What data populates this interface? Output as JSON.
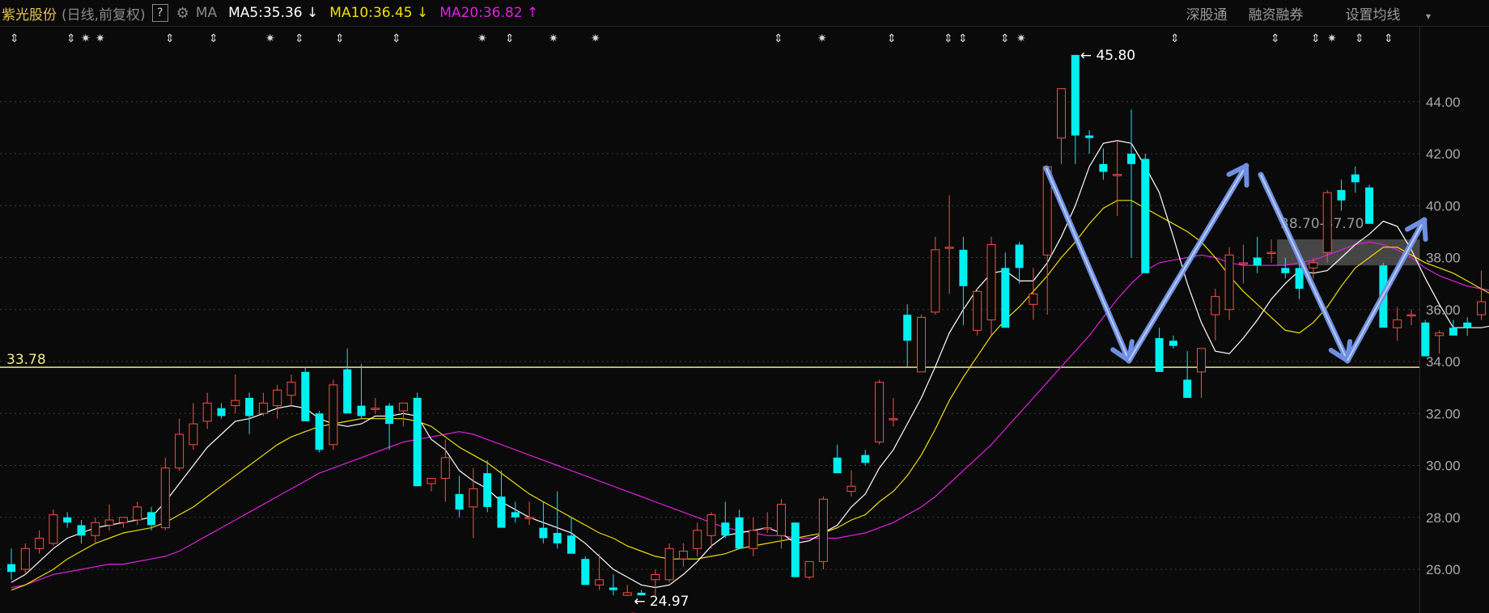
{
  "header": {
    "stock_name": "紫光股份",
    "mode": "(日线,前复权)",
    "help_label": "?",
    "ma_label": "MA",
    "ma5": "MA5:35.36",
    "ma5_arrow": "↓",
    "ma10": "MA10:36.45",
    "ma10_arrow": "↓",
    "ma20": "MA20:36.82",
    "ma20_arrow": "↑",
    "right_items": [
      "深股通",
      "融资融券",
      "设置均线"
    ],
    "dropdown_glyph": "▾"
  },
  "colors": {
    "up": "#ff4a4a",
    "down": "#00f0f0",
    "ma5": "#ffffff",
    "ma10": "#f0e000",
    "ma20": "#e020e0",
    "support": "#f0ea8a",
    "arrow": "#6f8fe0"
  },
  "chart_data": {
    "type": "candlestick",
    "yticks": [
      "44.00",
      "42.00",
      "40.00",
      "38.00",
      "36.00",
      "34.00",
      "32.00",
      "30.00",
      "28.00",
      "26.00"
    ],
    "ylim": [
      24.2,
      46.8
    ],
    "support_line": {
      "value": 33.78,
      "label": "33.78"
    },
    "zone": {
      "low": 37.7,
      "high": 38.7,
      "label": "38.70-37.70"
    },
    "high_label": "45.80",
    "low_label": "24.97",
    "low_marker": "S",
    "ohlc": [
      [
        26.2,
        26.8,
        25.6,
        25.9
      ],
      [
        26.0,
        27.0,
        25.8,
        26.8
      ],
      [
        26.8,
        27.5,
        26.6,
        27.2
      ],
      [
        27.0,
        28.3,
        26.9,
        28.1
      ],
      [
        28.0,
        28.2,
        27.6,
        27.8
      ],
      [
        27.7,
        27.9,
        27.0,
        27.3
      ],
      [
        27.3,
        28.0,
        27.0,
        27.8
      ],
      [
        27.7,
        28.5,
        27.5,
        27.9
      ],
      [
        27.8,
        28.0,
        27.6,
        28.0
      ],
      [
        27.9,
        28.6,
        27.7,
        28.4
      ],
      [
        28.2,
        28.4,
        27.5,
        27.7
      ],
      [
        27.6,
        30.3,
        27.5,
        29.9
      ],
      [
        29.9,
        31.8,
        29.8,
        31.2
      ],
      [
        30.8,
        32.4,
        30.6,
        31.6
      ],
      [
        31.7,
        32.8,
        31.4,
        32.4
      ],
      [
        32.2,
        32.4,
        31.8,
        31.9
      ],
      [
        32.3,
        33.5,
        32.0,
        32.5
      ],
      [
        32.6,
        32.8,
        31.2,
        31.9
      ],
      [
        32.0,
        32.8,
        31.9,
        32.4
      ],
      [
        32.3,
        33.1,
        31.8,
        32.9
      ],
      [
        32.7,
        33.5,
        32.3,
        33.2
      ],
      [
        33.6,
        33.8,
        31.8,
        31.7
      ],
      [
        32.0,
        32.1,
        30.5,
        30.6
      ],
      [
        30.8,
        33.3,
        30.6,
        33.1
      ],
      [
        33.7,
        34.5,
        32.0,
        32.0
      ],
      [
        32.3,
        33.9,
        31.8,
        31.9
      ],
      [
        32.2,
        32.6,
        32.0,
        32.2
      ],
      [
        32.3,
        32.4,
        30.6,
        31.6
      ],
      [
        32.1,
        32.3,
        31.5,
        32.4
      ],
      [
        32.6,
        32.8,
        29.2,
        29.2
      ],
      [
        29.3,
        29.5,
        29.0,
        29.5
      ],
      [
        29.5,
        31.0,
        28.6,
        30.3
      ],
      [
        28.9,
        29.6,
        28.0,
        28.3
      ],
      [
        28.4,
        29.9,
        27.2,
        29.1
      ],
      [
        29.7,
        30.2,
        28.2,
        28.4
      ],
      [
        28.8,
        29.8,
        27.6,
        27.6
      ],
      [
        28.2,
        28.6,
        27.8,
        28.0
      ],
      [
        28.0,
        28.6,
        27.7,
        28.0
      ],
      [
        27.6,
        28.6,
        27.0,
        27.2
      ],
      [
        27.4,
        29.0,
        26.8,
        27.0
      ],
      [
        27.3,
        28.0,
        26.8,
        26.6
      ],
      [
        26.4,
        26.5,
        25.5,
        25.4
      ],
      [
        25.4,
        26.6,
        25.2,
        25.6
      ],
      [
        25.3,
        25.8,
        25.0,
        25.2
      ],
      [
        25.0,
        25.4,
        24.97,
        25.1
      ],
      [
        25.1,
        25.2,
        25.0,
        25.0
      ],
      [
        25.6,
        26.0,
        25.0,
        25.8
      ],
      [
        25.6,
        27.0,
        25.5,
        26.8
      ],
      [
        26.4,
        27.0,
        26.1,
        26.7
      ],
      [
        26.8,
        27.8,
        26.5,
        27.5
      ],
      [
        27.3,
        28.2,
        26.8,
        28.1
      ],
      [
        27.8,
        28.6,
        27.2,
        27.3
      ],
      [
        28.0,
        28.3,
        27.2,
        26.8
      ],
      [
        26.8,
        28.0,
        26.5,
        27.5
      ],
      [
        27.6,
        28.2,
        27.4,
        27.6
      ],
      [
        27.3,
        28.7,
        26.8,
        28.5
      ],
      [
        27.8,
        27.8,
        25.7,
        25.7
      ],
      [
        25.7,
        26.3,
        25.6,
        26.3
      ],
      [
        26.3,
        28.8,
        26.0,
        28.7
      ],
      [
        30.3,
        30.8,
        29.8,
        29.7
      ],
      [
        29.0,
        29.8,
        28.8,
        29.2
      ],
      [
        30.4,
        30.6,
        30.0,
        30.1
      ],
      [
        30.9,
        33.3,
        30.8,
        33.2
      ],
      [
        31.8,
        32.6,
        31.5,
        31.8
      ],
      [
        35.8,
        36.2,
        33.8,
        34.8
      ],
      [
        33.6,
        35.8,
        33.6,
        35.7
      ],
      [
        35.9,
        38.8,
        35.8,
        38.3
      ],
      [
        38.4,
        40.4,
        36.6,
        38.4
      ],
      [
        38.3,
        38.8,
        35.4,
        36.9
      ],
      [
        35.2,
        36.8,
        35.0,
        36.7
      ],
      [
        35.6,
        38.8,
        35.0,
        38.5
      ],
      [
        37.6,
        38.2,
        35.3,
        35.3
      ],
      [
        38.5,
        38.6,
        37.0,
        37.6
      ],
      [
        36.2,
        37.6,
        35.6,
        36.6
      ],
      [
        38.1,
        41.5,
        35.8,
        41.5
      ],
      [
        42.6,
        44.2,
        41.6,
        44.5
      ],
      [
        45.8,
        45.8,
        41.6,
        42.7
      ],
      [
        42.7,
        42.9,
        42.0,
        42.6
      ],
      [
        41.6,
        42.2,
        41.0,
        41.3
      ],
      [
        41.2,
        42.5,
        39.6,
        41.2
      ],
      [
        42.0,
        43.7,
        38.0,
        41.6
      ],
      [
        41.8,
        42.0,
        38.0,
        37.4
      ],
      [
        34.9,
        35.3,
        33.6,
        33.6
      ],
      [
        34.8,
        35.0,
        34.5,
        34.6
      ],
      [
        33.3,
        34.4,
        32.8,
        32.6
      ],
      [
        33.6,
        34.5,
        32.6,
        34.5
      ],
      [
        35.8,
        36.8,
        34.8,
        36.5
      ],
      [
        36.0,
        38.4,
        35.6,
        38.1
      ],
      [
        37.8,
        38.5,
        37.0,
        37.8
      ],
      [
        38.0,
        38.8,
        37.4,
        37.7
      ],
      [
        38.2,
        38.7,
        37.8,
        38.2
      ],
      [
        37.6,
        38.0,
        37.2,
        37.4
      ],
      [
        37.6,
        37.8,
        36.4,
        36.8
      ],
      [
        37.6,
        38.0,
        37.2,
        37.8
      ],
      [
        38.2,
        40.6,
        37.8,
        40.5
      ],
      [
        40.6,
        41.0,
        39.8,
        40.2
      ],
      [
        41.2,
        41.5,
        40.5,
        40.9
      ],
      [
        40.7,
        40.8,
        39.3,
        39.3
      ],
      [
        37.7,
        37.8,
        35.4,
        35.3
      ],
      [
        35.3,
        36.1,
        34.8,
        35.6
      ],
      [
        35.8,
        36.0,
        35.4,
        35.8
      ],
      [
        35.5,
        35.6,
        34.2,
        34.2
      ],
      [
        35.0,
        35.2,
        34.3,
        35.1
      ],
      [
        35.3,
        35.6,
        35.0,
        35.0
      ],
      [
        35.5,
        35.7,
        35.0,
        35.3
      ],
      [
        35.8,
        37.5,
        35.6,
        36.3
      ],
      [
        36.1,
        36.6,
        35.8,
        35.9
      ]
    ],
    "ma5": [
      25.5,
      25.8,
      26.3,
      26.8,
      27.2,
      27.4,
      27.6,
      27.7,
      27.8,
      27.9,
      28.0,
      28.6,
      29.3,
      30.0,
      30.7,
      31.2,
      31.7,
      31.8,
      32.0,
      32.2,
      32.3,
      32.2,
      31.8,
      31.6,
      31.5,
      31.6,
      31.9,
      31.9,
      32.0,
      31.9,
      31.0,
      30.6,
      29.8,
      29.4,
      29.1,
      28.6,
      28.3,
      28.0,
      27.8,
      27.6,
      27.4,
      27.0,
      26.5,
      26.0,
      25.7,
      25.4,
      25.3,
      25.4,
      25.8,
      26.3,
      26.9,
      27.3,
      27.4,
      27.5,
      27.6,
      27.4,
      27.0,
      27.1,
      27.4,
      27.7,
      28.4,
      28.9,
      29.9,
      30.6,
      31.6,
      32.6,
      33.8,
      35.1,
      36.0,
      36.8,
      37.4,
      37.5,
      37.1,
      37.1,
      37.8,
      38.8,
      40.0,
      41.5,
      42.4,
      42.5,
      42.4,
      41.5,
      40.5,
      38.8,
      37.0,
      35.5,
      34.4,
      34.3,
      34.9,
      35.6,
      36.4,
      37.0,
      37.5,
      37.4,
      37.5,
      38.0,
      38.5,
      38.9,
      39.4,
      39.2,
      38.3,
      37.2,
      36.2,
      35.3,
      35.3,
      35.3,
      35.4,
      35.4,
      35.3
    ],
    "ma10": [
      25.2,
      25.4,
      25.7,
      26.0,
      26.4,
      26.7,
      27.0,
      27.2,
      27.4,
      27.5,
      27.6,
      27.8,
      28.1,
      28.4,
      28.8,
      29.2,
      29.6,
      30.0,
      30.4,
      30.8,
      31.1,
      31.3,
      31.5,
      31.6,
      31.7,
      31.8,
      31.8,
      31.8,
      31.8,
      31.7,
      31.5,
      31.1,
      30.7,
      30.4,
      30.1,
      29.7,
      29.3,
      28.9,
      28.6,
      28.3,
      28.0,
      27.7,
      27.4,
      27.2,
      26.9,
      26.7,
      26.5,
      26.4,
      26.4,
      26.4,
      26.5,
      26.6,
      26.8,
      26.9,
      27.0,
      27.1,
      27.2,
      27.3,
      27.4,
      27.6,
      27.9,
      28.1,
      28.6,
      29.0,
      29.6,
      30.4,
      31.4,
      32.5,
      33.4,
      34.2,
      35.0,
      35.6,
      36.1,
      36.7,
      37.3,
      38.0,
      38.6,
      39.3,
      39.9,
      40.2,
      40.2,
      39.9,
      39.6,
      39.3,
      39.0,
      38.6,
      38.0,
      37.3,
      36.7,
      36.2,
      35.7,
      35.2,
      35.1,
      35.5,
      36.1,
      36.9,
      37.6,
      38.0,
      38.4,
      38.4,
      38.1,
      37.8,
      37.6,
      37.4,
      37.1,
      36.8,
      36.5,
      36.4,
      36.3
    ],
    "ma20": [
      25.3,
      25.4,
      25.6,
      25.8,
      25.9,
      26.0,
      26.1,
      26.2,
      26.2,
      26.3,
      26.4,
      26.5,
      26.7,
      27.0,
      27.3,
      27.6,
      27.9,
      28.2,
      28.5,
      28.8,
      29.1,
      29.4,
      29.7,
      29.9,
      30.1,
      30.3,
      30.5,
      30.7,
      30.9,
      31.0,
      31.1,
      31.2,
      31.3,
      31.2,
      31.0,
      30.8,
      30.6,
      30.4,
      30.2,
      30.0,
      29.8,
      29.6,
      29.4,
      29.2,
      29.0,
      28.8,
      28.6,
      28.4,
      28.2,
      28.0,
      27.8,
      27.6,
      27.5,
      27.4,
      27.3,
      27.3,
      27.2,
      27.2,
      27.2,
      27.2,
      27.3,
      27.4,
      27.6,
      27.8,
      28.1,
      28.4,
      28.8,
      29.3,
      29.8,
      30.3,
      30.8,
      31.4,
      32.0,
      32.6,
      33.2,
      33.8,
      34.4,
      35.0,
      35.7,
      36.4,
      37.0,
      37.5,
      37.8,
      37.9,
      38.0,
      38.1,
      38.0,
      37.8,
      37.7,
      37.7,
      37.7,
      37.7,
      37.8,
      37.9,
      38.1,
      38.3,
      38.5,
      38.6,
      38.5,
      38.3,
      38.0,
      37.6,
      37.3,
      37.1,
      36.9,
      36.8,
      36.7,
      36.6,
      36.6
    ]
  }
}
